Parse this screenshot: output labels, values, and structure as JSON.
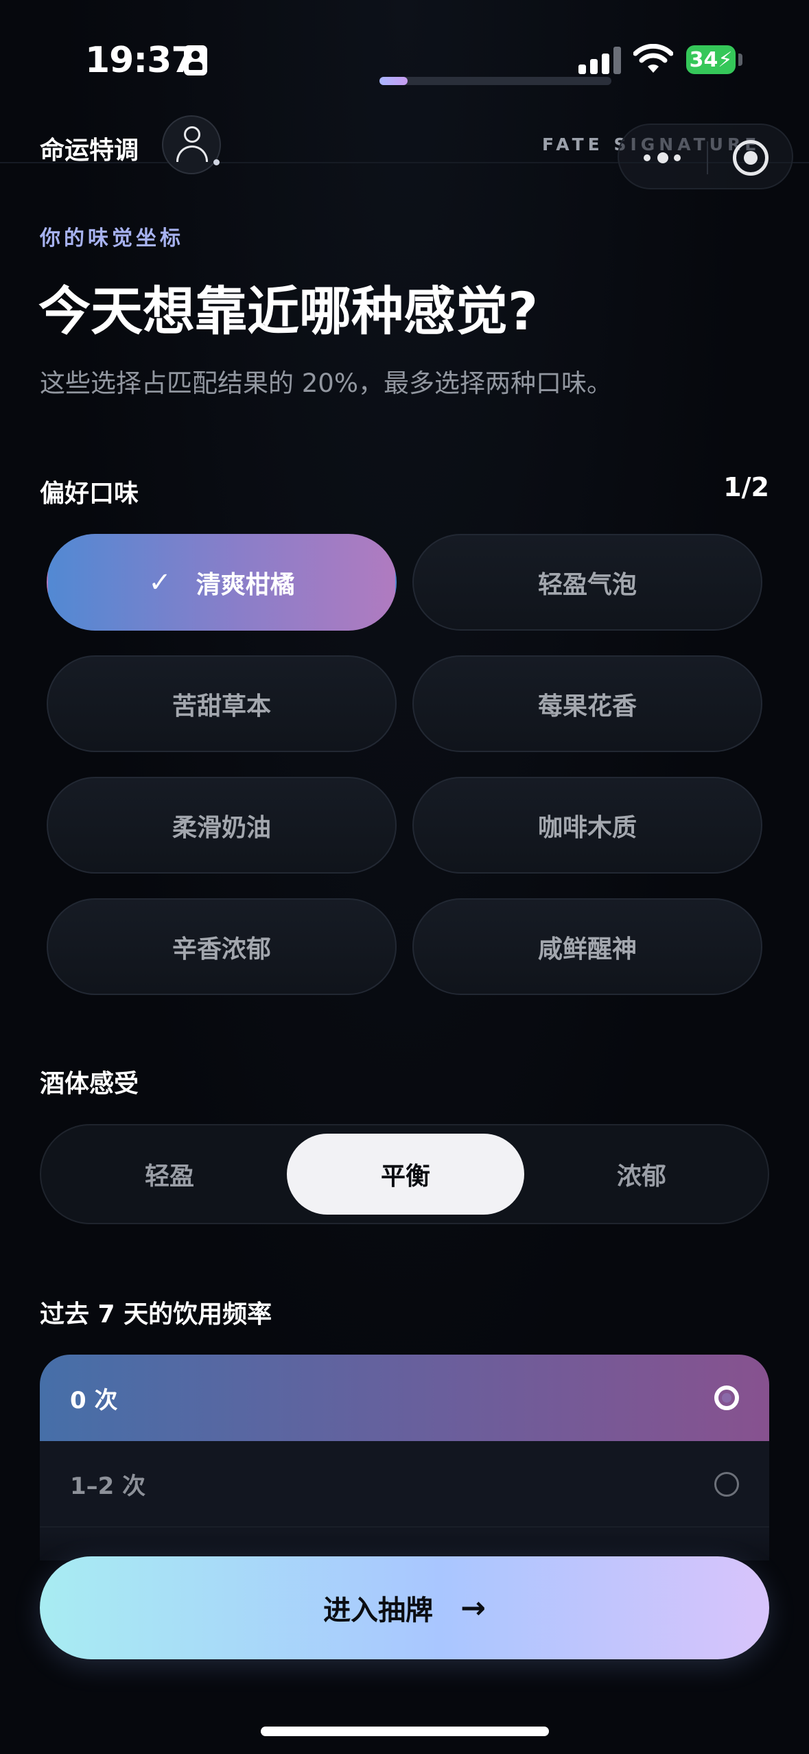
{
  "status_bar": {
    "time": "19:37",
    "battery": "34",
    "signal_icon": "cellular-signal-icon",
    "wifi_icon": "wifi-icon",
    "progress_fraction": 0.12
  },
  "header": {
    "app_title": "命运特调",
    "avatar_icon": "user-icon",
    "fate_label": "FATE SIGNATURE",
    "more_icon": "more-dots-icon",
    "target_icon": "target-icon"
  },
  "intro": {
    "eyebrow": "你的味觉坐标",
    "headline": "今天想靠近哪种感觉?",
    "subtext": "这些选择占匹配结果的 20%，最多选择两种口味。"
  },
  "flavor": {
    "title": "偏好口味",
    "counter": "1/2",
    "options": [
      {
        "label": "清爽柑橘",
        "selected": true
      },
      {
        "label": "轻盈气泡",
        "selected": false
      },
      {
        "label": "苦甜草本",
        "selected": false
      },
      {
        "label": "莓果花香",
        "selected": false
      },
      {
        "label": "柔滑奶油",
        "selected": false
      },
      {
        "label": "咖啡木质",
        "selected": false
      },
      {
        "label": "辛香浓郁",
        "selected": false
      },
      {
        "label": "咸鲜醒神",
        "selected": false
      }
    ]
  },
  "body": {
    "title": "酒体感受",
    "options": [
      "轻盈",
      "平衡",
      "浓郁"
    ],
    "selected": "平衡"
  },
  "frequency": {
    "title": "过去 7 天的饮用频率",
    "options": [
      {
        "label": "0 次",
        "selected": true
      },
      {
        "label": "1–2 次",
        "selected": false
      },
      {
        "label": "",
        "selected": false
      }
    ]
  },
  "cta": {
    "label": "进入抽牌",
    "arrow": "→"
  },
  "colors": {
    "background": "#06080d",
    "accent_blue": "#5289d3",
    "accent_purple": "#b07bc0",
    "cta_start": "#a8ecf2",
    "cta_end": "#d8c4fb",
    "battery_green": "#35c759"
  }
}
